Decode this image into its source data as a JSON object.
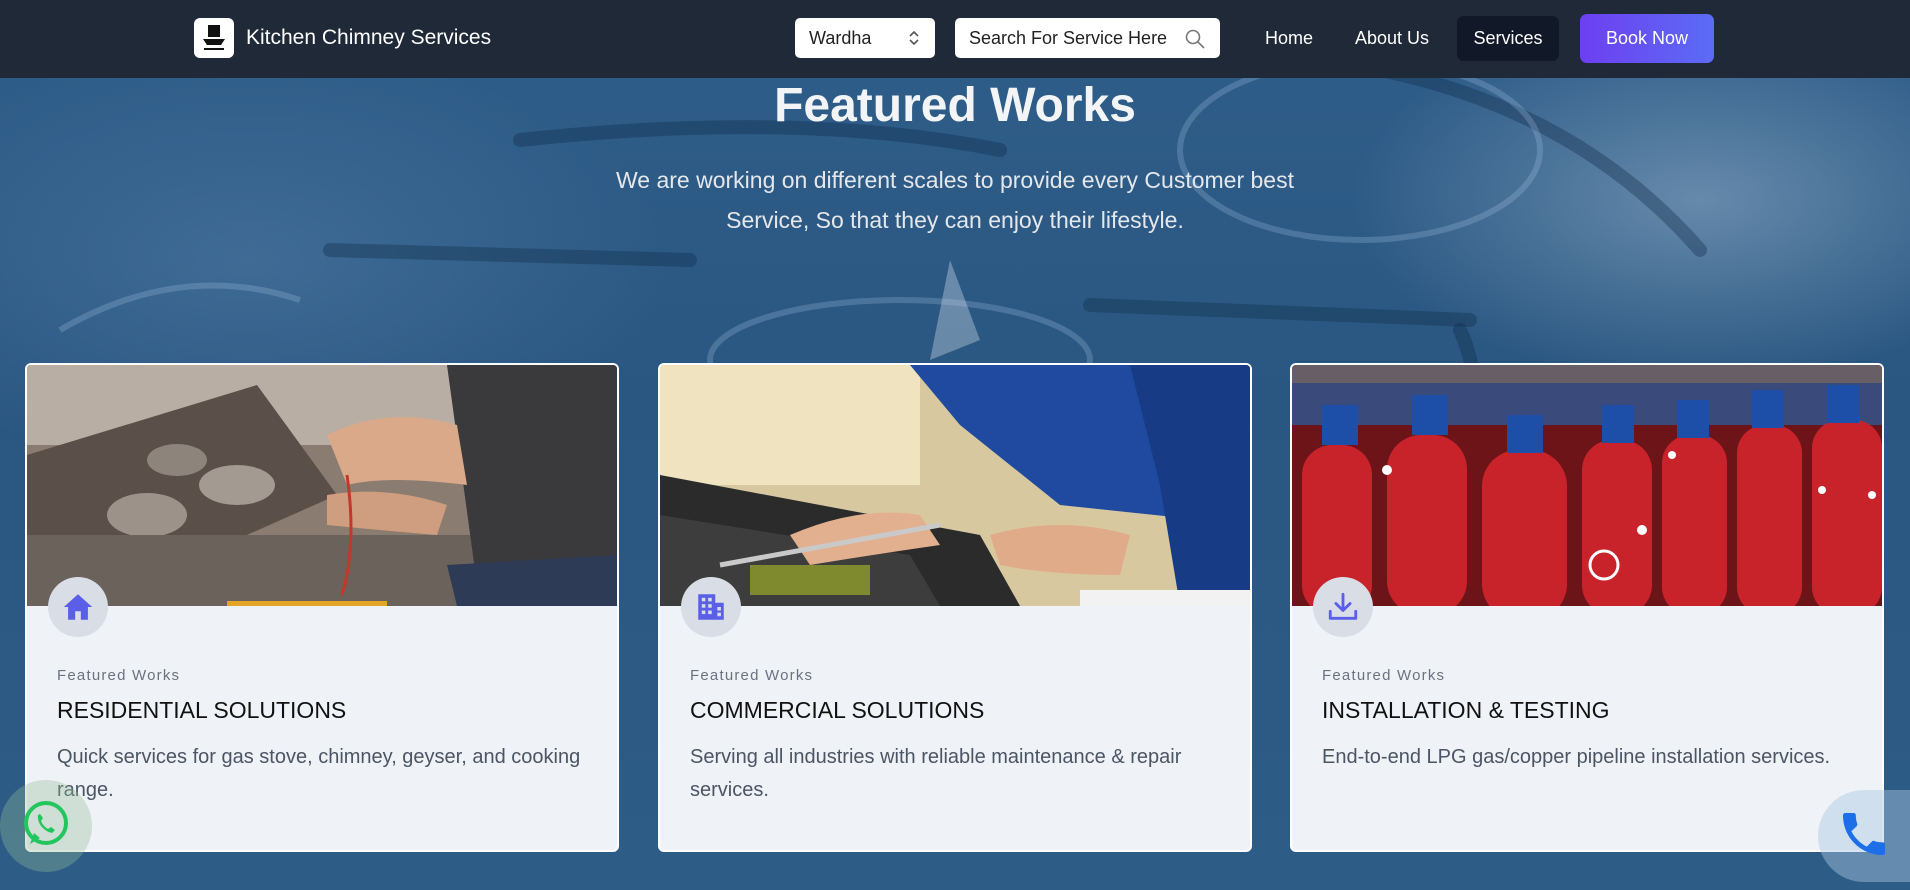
{
  "header": {
    "brand_name": "Kitchen Chimney Services",
    "city": "Wardha",
    "search_placeholder": "Search For Service Here",
    "nav": {
      "home": "Home",
      "about": "About Us",
      "services": "Services",
      "book": "Book Now"
    }
  },
  "section": {
    "title": "Featured Works",
    "subtitle": "We are working on different scales to provide every Customer best Service, So that they can enjoy their lifestyle."
  },
  "cards": [
    {
      "kicker": "Featured Works",
      "title": "RESIDENTIAL SOLUTIONS",
      "description": "Quick services for gas stove, chimney, geyser, and cooking range.",
      "icon": "home-icon"
    },
    {
      "kicker": "Featured Works",
      "title": "COMMERCIAL SOLUTIONS",
      "description": "Serving all industries with reliable maintenance & repair services.",
      "icon": "building-icon"
    },
    {
      "kicker": "Featured Works",
      "title": "INSTALLATION & TESTING",
      "description": "End-to-end LPG gas/copper pipeline installation services.",
      "icon": "download-icon"
    }
  ],
  "floating": {
    "whatsapp_icon": "whatsapp-icon",
    "phone_icon": "phone-icon"
  },
  "colors": {
    "header_bg": "#1f2937",
    "accent_gradient_start": "#6d3ff0",
    "accent_gradient_end": "#5b6cf5",
    "icon_color": "#5b5fe8",
    "card_bg": "#eff2f7"
  }
}
